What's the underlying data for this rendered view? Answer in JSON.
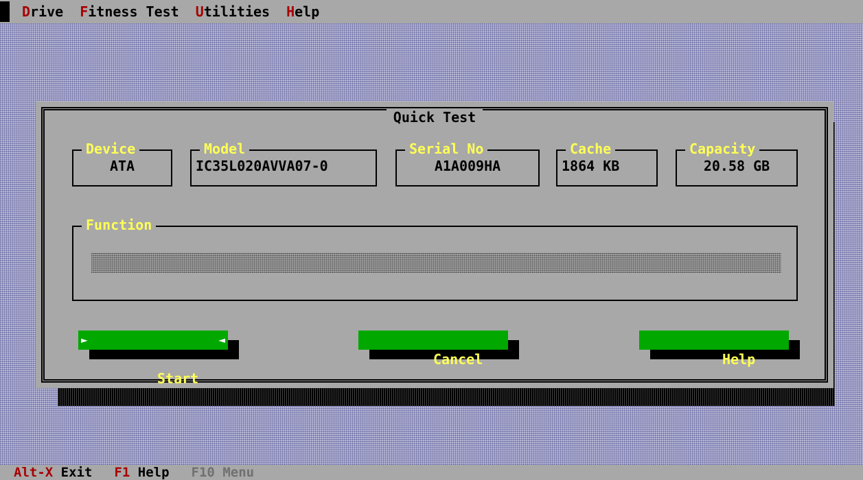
{
  "menu": [
    {
      "hot": "D",
      "rest": "rive"
    },
    {
      "hot": "F",
      "rest": "itness Test"
    },
    {
      "hot": "U",
      "rest": "tilities"
    },
    {
      "hot": "H",
      "rest": "elp"
    }
  ],
  "dialog": {
    "title": "Quick Test",
    "fields": {
      "device": {
        "label": "Device",
        "value": "ATA"
      },
      "model": {
        "label": "Model",
        "value": "IC35L020AVVA07-0"
      },
      "serial": {
        "label": "Serial No",
        "value": "A1A009HA"
      },
      "cache": {
        "label": "Cache",
        "value": "1864 KB"
      },
      "capacity": {
        "label": "Capacity",
        "value": "20.58 GB"
      }
    },
    "function": {
      "label": "Function",
      "progress": 0
    },
    "buttons": {
      "start": {
        "label": "Start",
        "left_arrow": "►",
        "right_arrow": "◄"
      },
      "cancel": {
        "label": "Cancel"
      },
      "help": {
        "label": "Help"
      }
    }
  },
  "status": [
    {
      "key": "Alt-X",
      "label": "Exit"
    },
    {
      "key": "F1",
      "label": "Help"
    },
    {
      "key": "F10",
      "label": "Menu"
    }
  ],
  "colors": {
    "hotkey": "#a80000",
    "label_yellow": "#ffff55",
    "button_green": "#00a800",
    "panel_gray": "#a8a8a8"
  }
}
